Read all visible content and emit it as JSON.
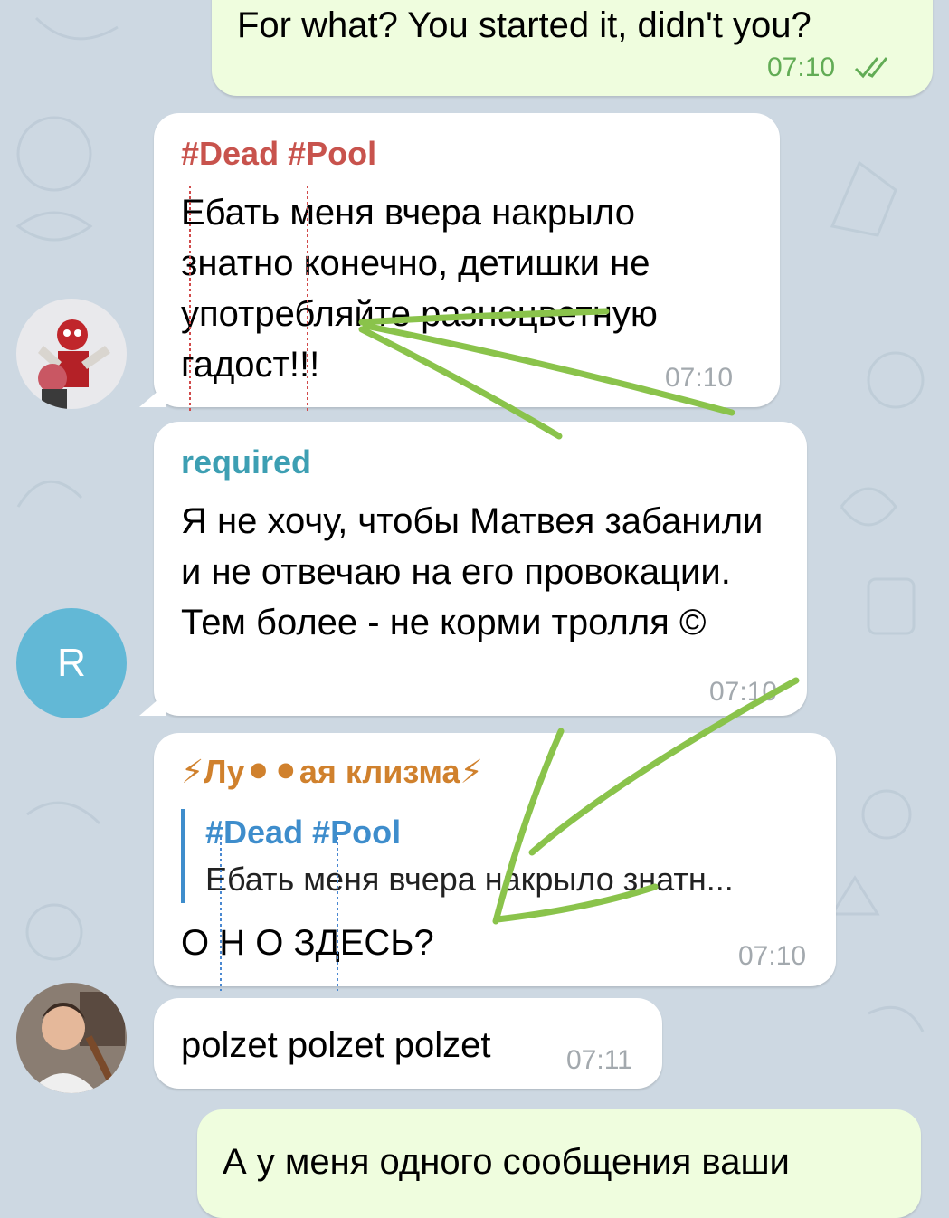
{
  "messages": [
    {
      "type": "outgoing",
      "text": "For what? You started it, didn't you?",
      "time": "07:10",
      "status": "read"
    },
    {
      "type": "incoming",
      "sender": "#Dead #Pool",
      "text": "Ебать меня вчера накрыло знатно конечно, детишки не употребляйте разноцветную гадост!!!",
      "time": "07:10"
    },
    {
      "type": "incoming",
      "sender": "required",
      "avatar_letter": "R",
      "text": "Я не хочу, чтобы Матвея забанили и не отвечаю на его провокации. Тем более - не корми тролля ©",
      "time": "07:10"
    },
    {
      "type": "incoming",
      "sender": "⚡Лу⚫⚫ая клизма⚡",
      "reply": {
        "title": "#Dead #Pool",
        "text": "Ебать меня вчера накрыло знатн..."
      },
      "text": "О Н О ЗДЕСЬ?",
      "time": "07:10"
    },
    {
      "type": "incoming",
      "text": "polzet polzet polzet",
      "time": "07:11"
    },
    {
      "type": "outgoing",
      "text": "А у меня одного сообщения ваши"
    }
  ],
  "colors": {
    "background": "#cdd8e2",
    "outgoing_bubble": "#effdde",
    "incoming_bubble": "#ffffff",
    "sender_deadpool": "#c8534d",
    "sender_required": "#3d9fb3",
    "sender_klizma": "#d0812d",
    "reply_accent": "#3e8dcc",
    "avatar_r": "#62b8d6",
    "annotation_stroke": "#8ac34b"
  },
  "icons": [
    "double-check-icon",
    "lightning-icon",
    "black-circle-icon"
  ]
}
